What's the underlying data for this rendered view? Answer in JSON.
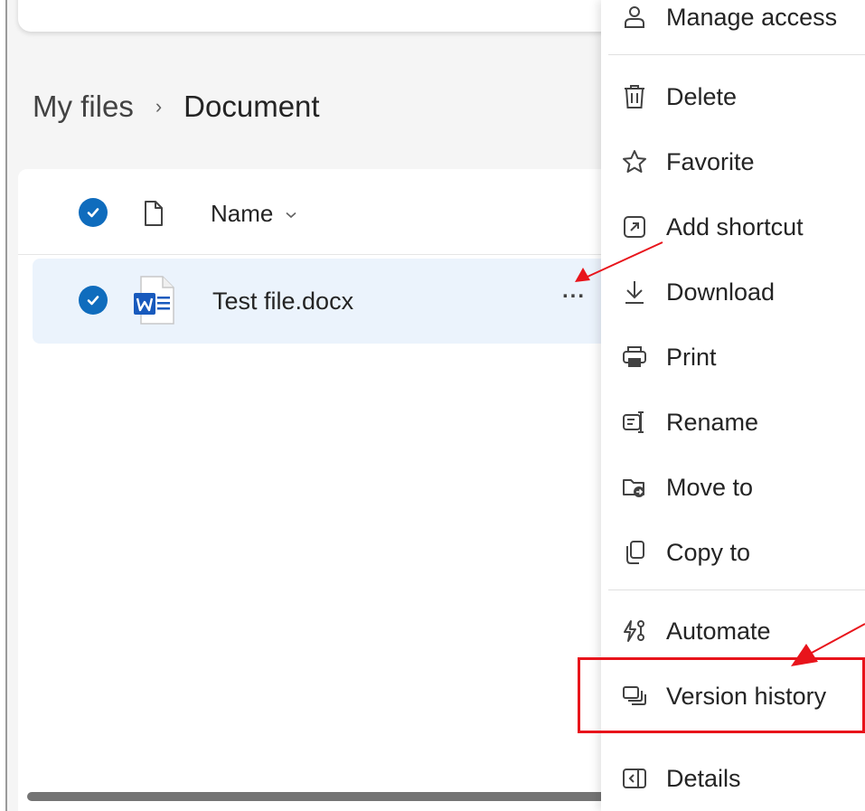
{
  "breadcrumb": {
    "root": "My files",
    "separator": "›",
    "current": "Document"
  },
  "list": {
    "header": {
      "select_all_icon": "checkmark-circle-icon",
      "file_type_icon": "document-icon",
      "name_label": "Name",
      "sort_icon": "chevron-down-icon"
    },
    "rows": [
      {
        "selected": true,
        "type_icon": "word-document-icon",
        "name": "Test file.docx",
        "more_label": "..."
      }
    ]
  },
  "context_menu": {
    "items": [
      {
        "label": "Manage access",
        "icon": "manage-access-icon"
      },
      {
        "label": "Delete",
        "icon": "trash-icon"
      },
      {
        "label": "Favorite",
        "icon": "star-icon"
      },
      {
        "label": "Add shortcut",
        "icon": "shortcut-icon"
      },
      {
        "label": "Download",
        "icon": "download-icon"
      },
      {
        "label": "Print",
        "icon": "print-icon"
      },
      {
        "label": "Rename",
        "icon": "rename-icon"
      },
      {
        "label": "Move to",
        "icon": "move-to-icon"
      },
      {
        "label": "Copy to",
        "icon": "copy-icon"
      },
      {
        "label": "Automate",
        "icon": "automate-icon"
      },
      {
        "label": "Version history",
        "icon": "version-history-icon"
      },
      {
        "label": "Details",
        "icon": "details-icon"
      }
    ]
  },
  "colors": {
    "accent": "#0f6cbd",
    "selected_row": "#ebf3fc",
    "annotation": "#e8141b",
    "word_blue": "#185abd"
  }
}
